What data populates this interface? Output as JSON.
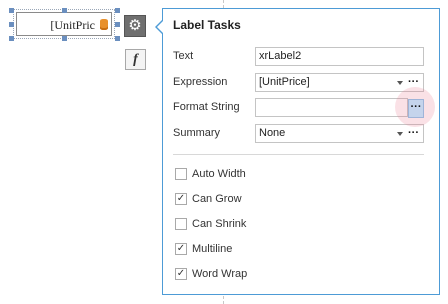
{
  "control": {
    "text": "[UnitPric",
    "icon": "database-icon"
  },
  "smart_tag": {
    "icon": "gear-icon",
    "symbol": "⚙"
  },
  "fx_button": {
    "label": "f",
    "icon": "function-icon"
  },
  "panel": {
    "title": "Label Tasks",
    "rows": {
      "text": {
        "label": "Text",
        "value": "xrLabel2"
      },
      "expression": {
        "label": "Expression",
        "value": "[UnitPrice]",
        "ellipsis": "···"
      },
      "format_string": {
        "label": "Format String",
        "value": "",
        "ellipsis": "···"
      },
      "summary": {
        "label": "Summary",
        "value": "None",
        "ellipsis": "···"
      }
    },
    "checkboxes": [
      {
        "label": "Auto Width",
        "checked": false
      },
      {
        "label": "Can Grow",
        "checked": true
      },
      {
        "label": "Can Shrink",
        "checked": false
      },
      {
        "label": "Multiline",
        "checked": true
      },
      {
        "label": "Word Wrap",
        "checked": true
      }
    ],
    "check_mark": "✓"
  },
  "colors": {
    "panel_border": "#4d9bd6",
    "gear_button": "#6f6f6f",
    "ellipsis_highlight": "#c5d4ec",
    "db_icon": "#e8902c"
  }
}
